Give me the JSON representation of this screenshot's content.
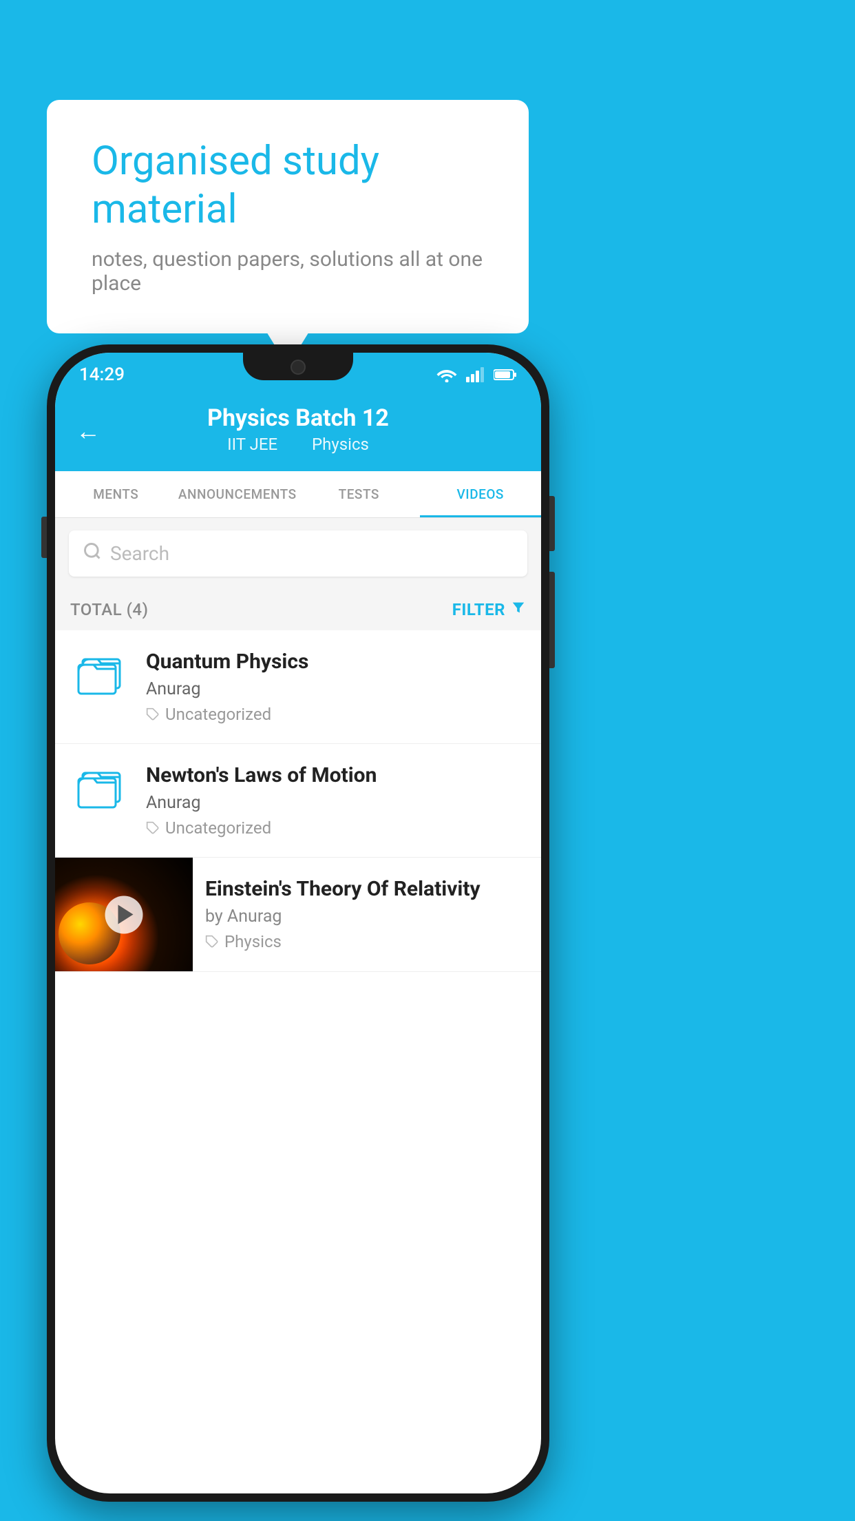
{
  "background_color": "#1ab8e8",
  "speech_bubble": {
    "title": "Organised study material",
    "subtitle": "notes, question papers, solutions all at one place"
  },
  "phone": {
    "status_bar": {
      "time": "14:29"
    },
    "top_bar": {
      "title": "Physics Batch 12",
      "subtitle_left": "IIT JEE",
      "subtitle_right": "Physics",
      "back_label": "←"
    },
    "tabs": [
      {
        "label": "MENTS",
        "active": false
      },
      {
        "label": "ANNOUNCEMENTS",
        "active": false
      },
      {
        "label": "TESTS",
        "active": false
      },
      {
        "label": "VIDEOS",
        "active": true
      }
    ],
    "search": {
      "placeholder": "Search"
    },
    "filter_bar": {
      "total_label": "TOTAL (4)",
      "filter_label": "FILTER"
    },
    "items": [
      {
        "type": "folder",
        "title": "Quantum Physics",
        "author": "Anurag",
        "tag": "Uncategorized"
      },
      {
        "type": "folder",
        "title": "Newton's Laws of Motion",
        "author": "Anurag",
        "tag": "Uncategorized"
      },
      {
        "type": "video",
        "title": "Einstein's Theory Of Relativity",
        "author": "by Anurag",
        "tag": "Physics"
      }
    ]
  }
}
